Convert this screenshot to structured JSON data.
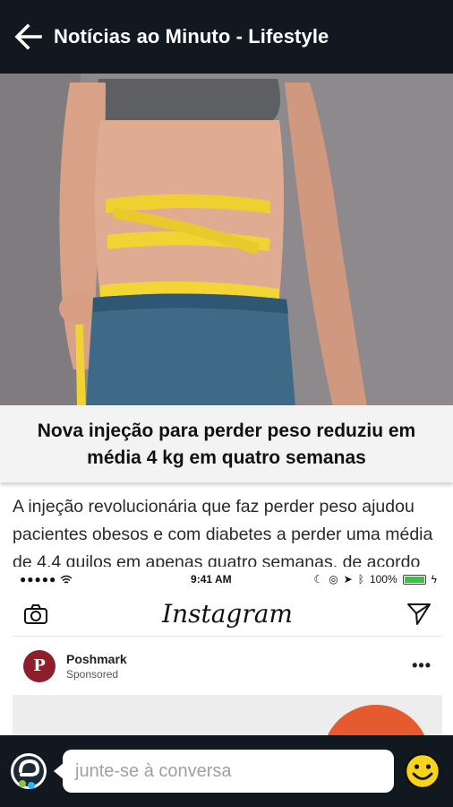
{
  "header": {
    "title": "Notícias ao Minuto - Lifestyle",
    "back_icon": "arrow-left-icon"
  },
  "article": {
    "headline": "Nova injeção para perder peso reduziu em média 4 kg em quatro semanas",
    "summary": "A injeção revolucionária que faz perder peso ajudou pacientes obesos e com diabetes a perder uma média de 4,4 quilos em apenas quatro semanas, de acordo com um novo estudo."
  },
  "embed": {
    "status_left": "●●●●● ",
    "time": "9:41 AM",
    "battery": "100%",
    "app_name": "Instagram",
    "account_name": "Poshmark",
    "account_sub": "Sponsored",
    "more": "•••",
    "colors": {
      "battery_fill": "#3cc447",
      "poshmark": "#8d1f2d",
      "orange": "#e55a2e"
    }
  },
  "footer": {
    "chat_placeholder": "junte-se à conversa",
    "emoji_icon": "smiley-icon"
  },
  "colors": {
    "bar_bg": "#121820",
    "emoji_yellow": "#f7d418"
  }
}
